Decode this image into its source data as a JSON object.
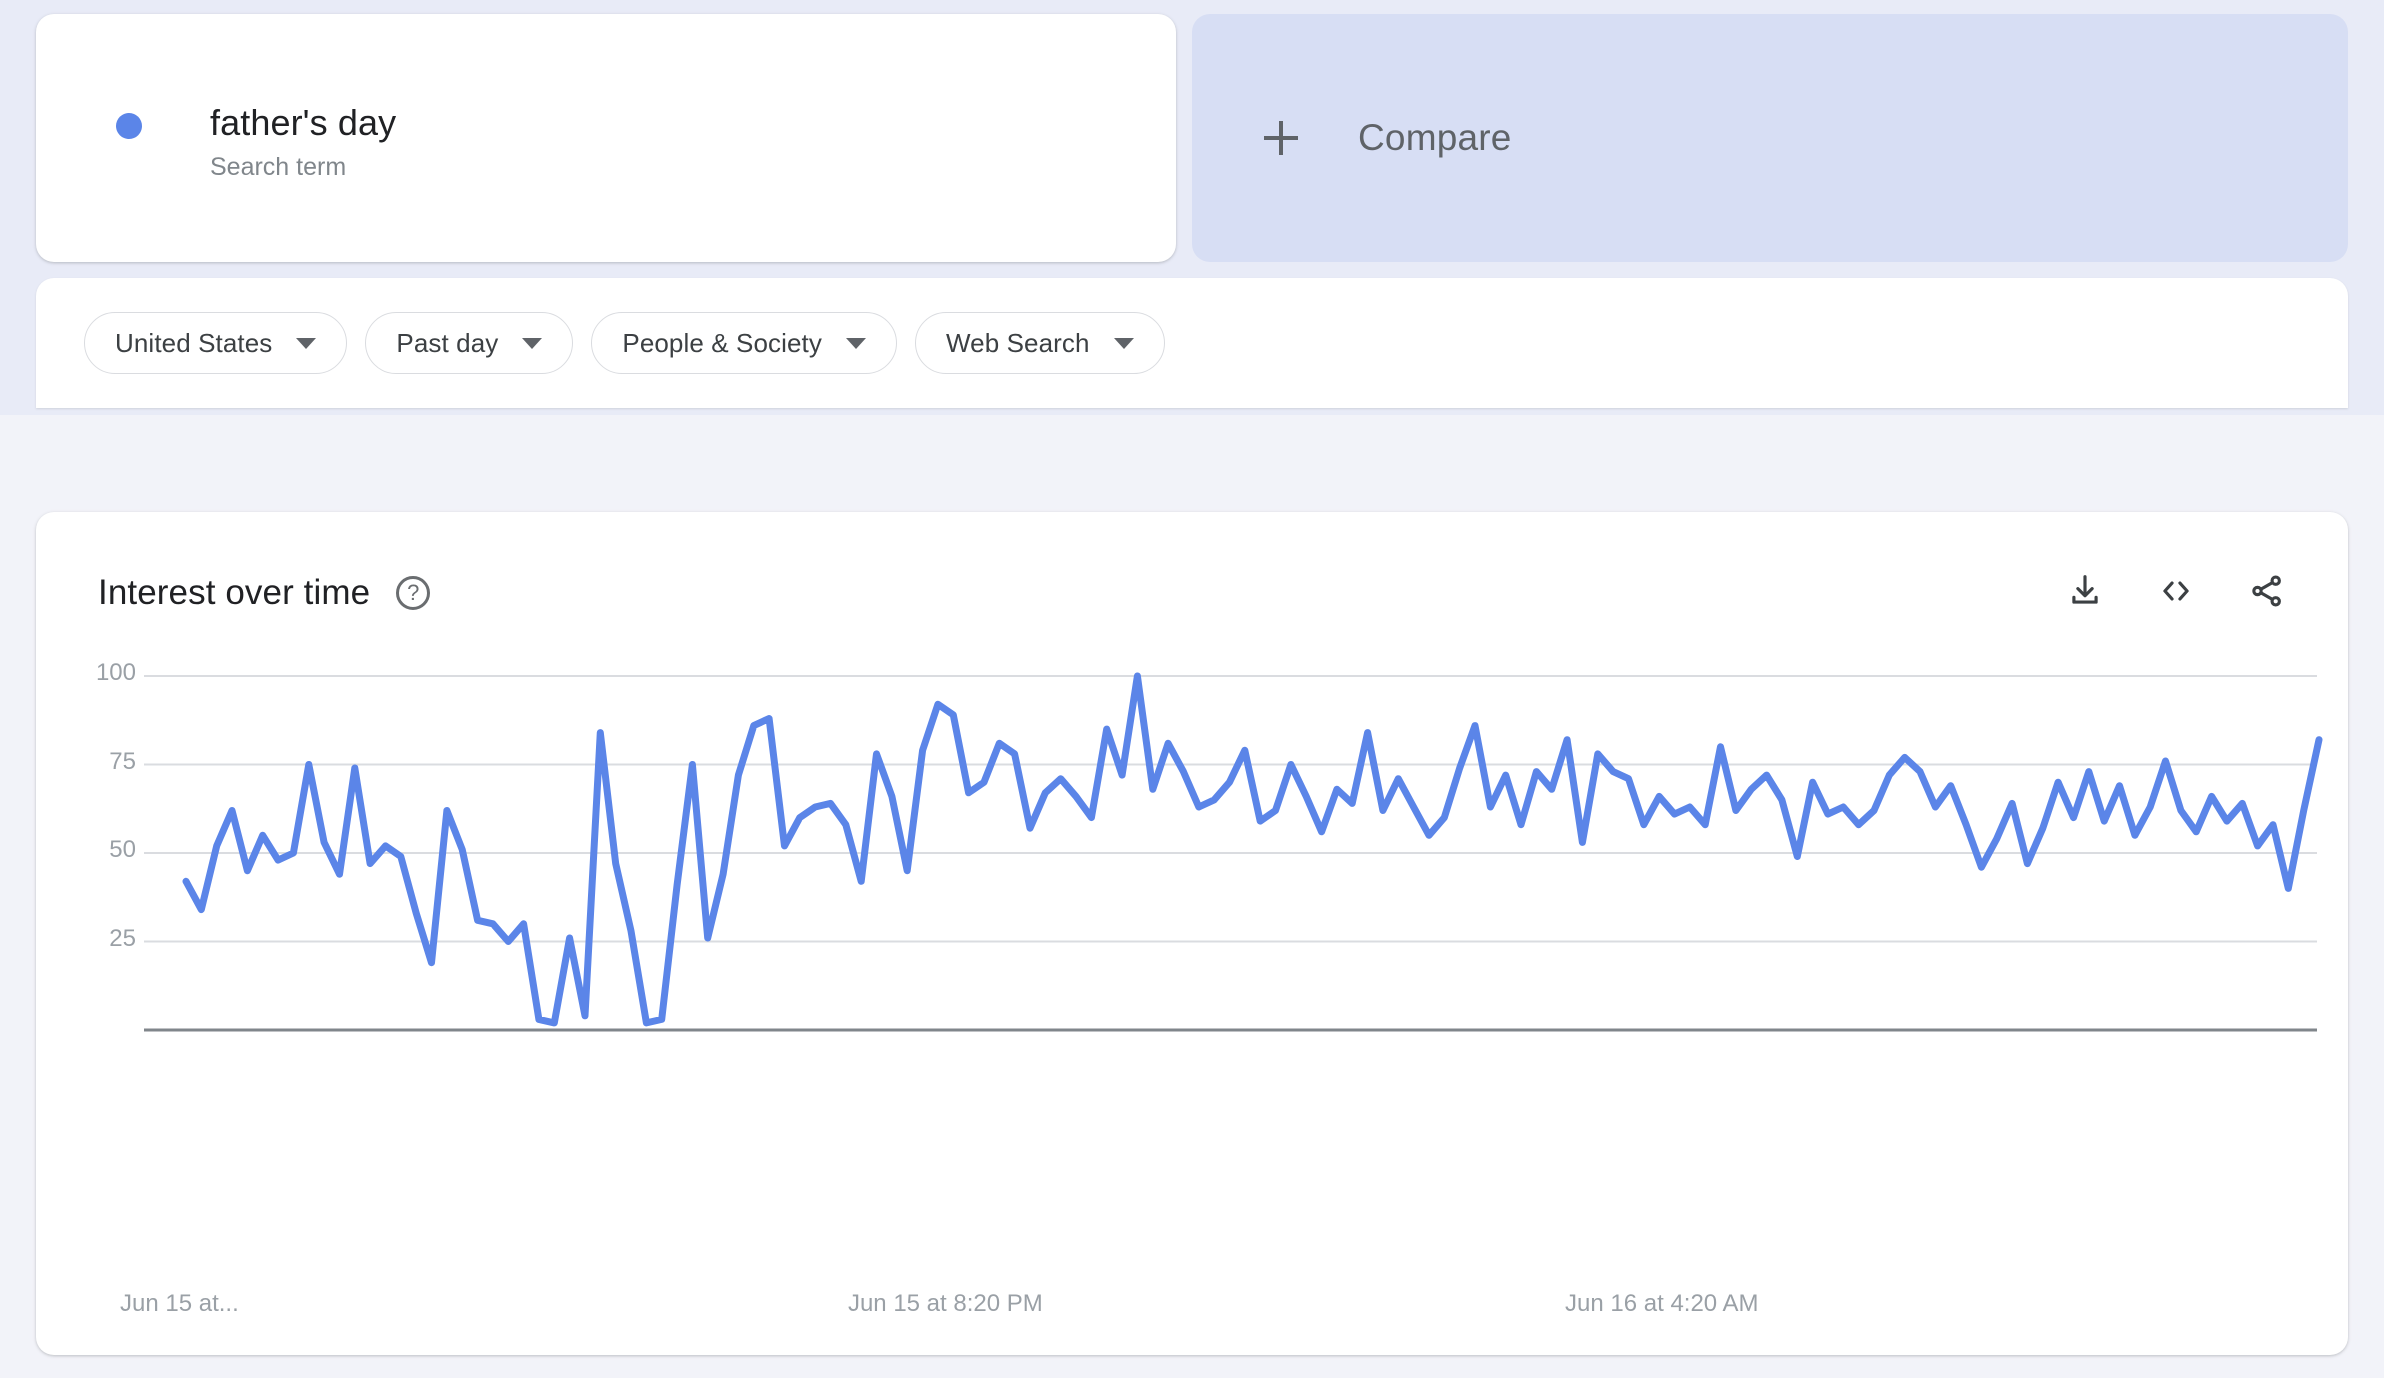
{
  "theme": {
    "accent": "#5b85e8",
    "band_bg": "#e8ebf7",
    "page_bg": "#f2f3f9",
    "compare_bg": "#d7def4",
    "card_bg": "#ffffff",
    "gridline": "#dadce0",
    "axis": "#80868b",
    "muted_text": "#9aa0a6"
  },
  "search_term": {
    "name": "father's day",
    "type_label": "Search term",
    "dot_icon": "series-color-dot"
  },
  "compare": {
    "label": "Compare",
    "icon": "plus-icon"
  },
  "filters": [
    {
      "label": "United States",
      "icon": "chevron-down-icon"
    },
    {
      "label": "Past day",
      "icon": "chevron-down-icon"
    },
    {
      "label": "People & Society",
      "icon": "chevron-down-icon"
    },
    {
      "label": "Web Search",
      "icon": "chevron-down-icon"
    }
  ],
  "interest_panel": {
    "title": "Interest over time",
    "help_icon": "help-circle-icon",
    "help_glyph": "?",
    "actions": [
      {
        "name": "download-icon",
        "tooltip": "Download"
      },
      {
        "name": "embed-code-icon",
        "tooltip": "Embed",
        "glyph": "<>"
      },
      {
        "name": "share-icon",
        "tooltip": "Share"
      }
    ]
  },
  "chart_data": {
    "type": "line",
    "title": "Interest over time",
    "xlabel": "",
    "ylabel": "",
    "ylim": [
      0,
      100
    ],
    "yticks": [
      100,
      75,
      50,
      25
    ],
    "grid": true,
    "legend_position": "top-left",
    "xtick_labels": [
      "Jun 15 at...",
      "Jun 15 at 8:20 PM",
      "Jun 16 at 4:20 AM"
    ],
    "xtick_positions": [
      0,
      0.335,
      0.665
    ],
    "series": [
      {
        "name": "father's day",
        "color": "#5b85e8",
        "values": [
          42,
          34,
          52,
          62,
          45,
          55,
          48,
          50,
          75,
          53,
          44,
          74,
          47,
          52,
          49,
          33,
          19,
          62,
          51,
          31,
          30,
          25,
          30,
          3,
          2,
          26,
          4,
          84,
          47,
          28,
          2,
          3,
          41,
          75,
          26,
          44,
          72,
          86,
          88,
          52,
          60,
          63,
          64,
          58,
          42,
          78,
          66,
          45,
          79,
          92,
          89,
          67,
          70,
          81,
          78,
          57,
          67,
          71,
          66,
          60,
          85,
          72,
          100,
          68,
          81,
          73,
          63,
          65,
          70,
          79,
          59,
          62,
          75,
          66,
          56,
          68,
          64,
          84,
          62,
          71,
          63,
          55,
          60,
          74,
          86,
          63,
          72,
          58,
          73,
          68,
          82,
          53,
          78,
          73,
          71,
          58,
          66,
          61,
          63,
          58,
          80,
          62,
          68,
          72,
          65,
          49,
          70,
          61,
          63,
          58,
          62,
          72,
          77,
          73,
          63,
          69,
          58,
          46,
          54,
          64,
          47,
          57,
          70,
          60,
          73,
          59,
          69,
          55,
          63,
          76,
          62,
          56,
          66,
          59,
          64,
          52,
          58,
          40,
          62,
          82
        ]
      }
    ]
  }
}
